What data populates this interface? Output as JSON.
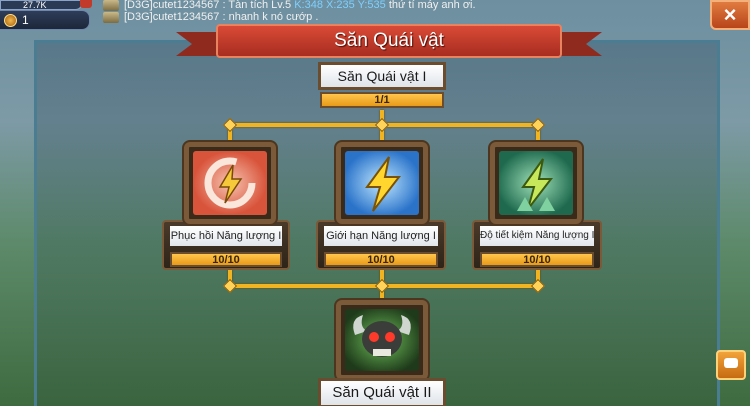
{
  "hud": {
    "top_value": "27.7K",
    "power_value": "1"
  },
  "chat": {
    "line1_user": "[D3G]cutet1234567",
    "line1_text": ": Tàn tích Lv.5",
    "line1_coord": "K:348 X:235 Y:535",
    "line1_tail": "thứ tí máy anh ơi.",
    "line2_user": "[D3G]cutet1234567",
    "line2_text": ": nhanh k nó cướp ."
  },
  "window": {
    "title": "Săn Quái vật",
    "close_icon": "×"
  },
  "colors": {
    "banner": "#c43a2a",
    "wire": "#f0b423",
    "progress": "#f2a81f",
    "frame": "#7a5a38"
  },
  "tree": {
    "root": {
      "label": "Săn Quái vật I",
      "progress_text": "1/1",
      "progress": 1.0
    },
    "skills": [
      {
        "label": "Phục hồi Năng lượng I",
        "progress_text": "10/10",
        "progress": 1.0,
        "icon": "energy-restore-icon"
      },
      {
        "label": "Giới hạn Năng lượng I",
        "progress_text": "10/10",
        "progress": 1.0,
        "icon": "energy-limit-icon"
      },
      {
        "label": "Độ tiết kiệm Năng lượng I",
        "progress_text": "10/10",
        "progress": 1.0,
        "icon": "energy-saving-icon"
      }
    ],
    "next": {
      "label": "Săn Quái vật II",
      "icon": "monster-skull-icon"
    }
  }
}
